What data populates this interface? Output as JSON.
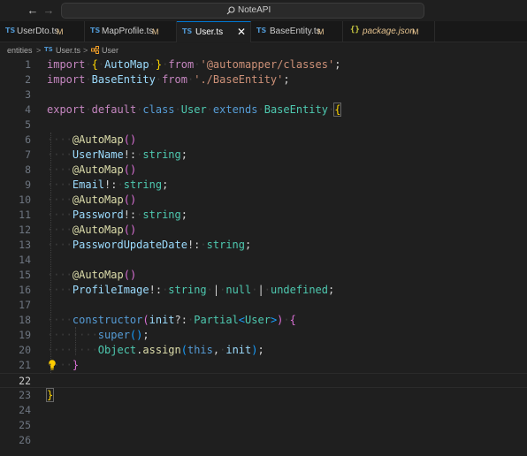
{
  "titlebar": {
    "back_icon": "arrow-left-icon",
    "forward_icon": "arrow-right-icon",
    "search_label": "NoteAPI"
  },
  "tabs": [
    {
      "label": "UserDto.ts",
      "badge": "M",
      "icon": "TS"
    },
    {
      "label": "MapProfile.ts",
      "badge": "M",
      "icon": "TS"
    },
    {
      "label": "User.ts",
      "badge": "",
      "icon": "TS",
      "close": "✕"
    },
    {
      "label": "BaseEntity.ts",
      "badge": "M",
      "icon": "TS"
    },
    {
      "label": "package.json",
      "badge": "M",
      "icon": "{}"
    }
  ],
  "breadcrumb": {
    "folder": "entities",
    "file": "User.ts",
    "file_icon": "TS",
    "symbol": "User",
    "separator": ">"
  },
  "editor": {
    "line_numbers": [
      "1",
      "2",
      "3",
      "4",
      "5",
      "6",
      "7",
      "8",
      "9",
      "10",
      "11",
      "12",
      "13",
      "14",
      "15",
      "16",
      "17",
      "18",
      "19",
      "20",
      "21",
      "22",
      "23",
      "24",
      "25",
      "26"
    ],
    "current_line": "22",
    "tokens": {
      "import": "import",
      "lbrace": "{",
      "rbrace": "}",
      "automap_id": "AutoMap",
      "from": "from",
      "automapper_pkg": "'@automapper/classes'",
      "semi": ";",
      "baseentity_id": "BaseEntity",
      "baseentity_path": "'./BaseEntity'",
      "export": "export",
      "default": "default",
      "class": "class",
      "user": "User",
      "extends": "extends",
      "at": "@",
      "parens": "()",
      "username": "UserName",
      "excl_colon": "!:",
      "string": "string",
      "email": "Email",
      "password": "Password",
      "password_update_date": "PasswordUpdateDate",
      "profile_image": "ProfileImage",
      "pipe": "|",
      "null": "null",
      "undefined": "undefined",
      "constructor": "constructor",
      "lparen": "(",
      "rparen": ")",
      "init": "init",
      "qcolon": "?:",
      "partial": "Partial",
      "lt": "<",
      "gt": ">",
      "super": "super",
      "object": "Object",
      "dot": ".",
      "assign": "assign",
      "this": "this",
      "comma": ","
    }
  }
}
